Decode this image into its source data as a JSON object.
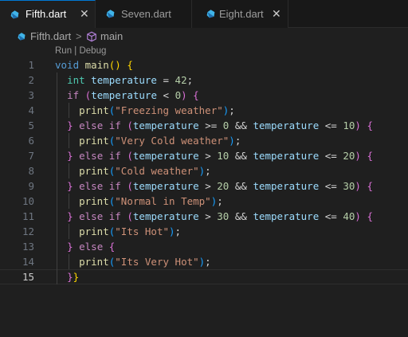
{
  "tabs": [
    {
      "label": "Fifth.dart",
      "active": true,
      "close": "✕"
    },
    {
      "label": "Seven.dart",
      "active": false
    },
    {
      "label": "Eight.dart",
      "active": false,
      "close": "✕"
    }
  ],
  "breadcrumb": {
    "file": "Fifth.dart",
    "separator": ">",
    "symbol": "main"
  },
  "editor": {
    "codelens": "Run | Debug",
    "line_numbers": [
      "1",
      "2",
      "3",
      "4",
      "5",
      "6",
      "7",
      "8",
      "9",
      "10",
      "11",
      "12",
      "13",
      "14",
      "15"
    ],
    "current_line": 15,
    "code_lines": [
      [
        [
          "kw",
          "void"
        ],
        [
          "pun",
          " "
        ],
        [
          "fn",
          "main"
        ],
        [
          "b1",
          "()"
        ],
        [
          "pun",
          " "
        ],
        [
          "b1",
          "{"
        ]
      ],
      [
        [
          "pun",
          "  "
        ],
        [
          "ty",
          "int"
        ],
        [
          "pun",
          " "
        ],
        [
          "var",
          "temperature"
        ],
        [
          "pun",
          " = "
        ],
        [
          "num",
          "42"
        ],
        [
          "pun",
          ";"
        ]
      ],
      [
        [
          "pun",
          "  "
        ],
        [
          "ctl",
          "if"
        ],
        [
          "pun",
          " "
        ],
        [
          "b2",
          "("
        ],
        [
          "var",
          "temperature"
        ],
        [
          "pun",
          " < "
        ],
        [
          "num",
          "0"
        ],
        [
          "b2",
          ")"
        ],
        [
          "pun",
          " "
        ],
        [
          "b2",
          "{"
        ]
      ],
      [
        [
          "pun",
          "    "
        ],
        [
          "fn",
          "print"
        ],
        [
          "b3",
          "("
        ],
        [
          "str",
          "\"Freezing weather\""
        ],
        [
          "b3",
          ")"
        ],
        [
          "pun",
          ";"
        ]
      ],
      [
        [
          "pun",
          "  "
        ],
        [
          "b2",
          "}"
        ],
        [
          "pun",
          " "
        ],
        [
          "ctl",
          "else"
        ],
        [
          "pun",
          " "
        ],
        [
          "ctl",
          "if"
        ],
        [
          "pun",
          " "
        ],
        [
          "b2",
          "("
        ],
        [
          "var",
          "temperature"
        ],
        [
          "pun",
          " >= "
        ],
        [
          "num",
          "0"
        ],
        [
          "pun",
          " && "
        ],
        [
          "var",
          "temperature"
        ],
        [
          "pun",
          " <= "
        ],
        [
          "num",
          "10"
        ],
        [
          "b2",
          ")"
        ],
        [
          "pun",
          " "
        ],
        [
          "b2",
          "{"
        ]
      ],
      [
        [
          "pun",
          "    "
        ],
        [
          "fn",
          "print"
        ],
        [
          "b3",
          "("
        ],
        [
          "str",
          "\"Very Cold weather\""
        ],
        [
          "b3",
          ")"
        ],
        [
          "pun",
          ";"
        ]
      ],
      [
        [
          "pun",
          "  "
        ],
        [
          "b2",
          "}"
        ],
        [
          "pun",
          " "
        ],
        [
          "ctl",
          "else"
        ],
        [
          "pun",
          " "
        ],
        [
          "ctl",
          "if"
        ],
        [
          "pun",
          " "
        ],
        [
          "b2",
          "("
        ],
        [
          "var",
          "temperature"
        ],
        [
          "pun",
          " > "
        ],
        [
          "num",
          "10"
        ],
        [
          "pun",
          " && "
        ],
        [
          "var",
          "temperature"
        ],
        [
          "pun",
          " <= "
        ],
        [
          "num",
          "20"
        ],
        [
          "b2",
          ")"
        ],
        [
          "pun",
          " "
        ],
        [
          "b2",
          "{"
        ]
      ],
      [
        [
          "pun",
          "    "
        ],
        [
          "fn",
          "print"
        ],
        [
          "b3",
          "("
        ],
        [
          "str",
          "\"Cold weather\""
        ],
        [
          "b3",
          ")"
        ],
        [
          "pun",
          ";"
        ]
      ],
      [
        [
          "pun",
          "  "
        ],
        [
          "b2",
          "}"
        ],
        [
          "pun",
          " "
        ],
        [
          "ctl",
          "else"
        ],
        [
          "pun",
          " "
        ],
        [
          "ctl",
          "if"
        ],
        [
          "pun",
          " "
        ],
        [
          "b2",
          "("
        ],
        [
          "var",
          "temperature"
        ],
        [
          "pun",
          " > "
        ],
        [
          "num",
          "20"
        ],
        [
          "pun",
          " && "
        ],
        [
          "var",
          "temperature"
        ],
        [
          "pun",
          " <= "
        ],
        [
          "num",
          "30"
        ],
        [
          "b2",
          ")"
        ],
        [
          "pun",
          " "
        ],
        [
          "b2",
          "{"
        ]
      ],
      [
        [
          "pun",
          "    "
        ],
        [
          "fn",
          "print"
        ],
        [
          "b3",
          "("
        ],
        [
          "str",
          "\"Normal in Temp\""
        ],
        [
          "b3",
          ")"
        ],
        [
          "pun",
          ";"
        ]
      ],
      [
        [
          "pun",
          "  "
        ],
        [
          "b2",
          "}"
        ],
        [
          "pun",
          " "
        ],
        [
          "ctl",
          "else"
        ],
        [
          "pun",
          " "
        ],
        [
          "ctl",
          "if"
        ],
        [
          "pun",
          " "
        ],
        [
          "b2",
          "("
        ],
        [
          "var",
          "temperature"
        ],
        [
          "pun",
          " > "
        ],
        [
          "num",
          "30"
        ],
        [
          "pun",
          " && "
        ],
        [
          "var",
          "temperature"
        ],
        [
          "pun",
          " <= "
        ],
        [
          "num",
          "40"
        ],
        [
          "b2",
          ")"
        ],
        [
          "pun",
          " "
        ],
        [
          "b2",
          "{"
        ]
      ],
      [
        [
          "pun",
          "    "
        ],
        [
          "fn",
          "print"
        ],
        [
          "b3",
          "("
        ],
        [
          "str",
          "\"Its Hot\""
        ],
        [
          "b3",
          ")"
        ],
        [
          "pun",
          ";"
        ]
      ],
      [
        [
          "pun",
          "  "
        ],
        [
          "b2",
          "}"
        ],
        [
          "pun",
          " "
        ],
        [
          "ctl",
          "else"
        ],
        [
          "pun",
          " "
        ],
        [
          "b2",
          "{"
        ]
      ],
      [
        [
          "pun",
          "    "
        ],
        [
          "fn",
          "print"
        ],
        [
          "b3",
          "("
        ],
        [
          "str",
          "\"Its Very Hot\""
        ],
        [
          "b3",
          ")"
        ],
        [
          "pun",
          ";"
        ]
      ],
      [
        [
          "pun",
          "  "
        ],
        [
          "b2",
          "}"
        ],
        [
          "b1",
          "}"
        ]
      ]
    ]
  },
  "colors": {
    "background": "#1f1f1f",
    "tab_bar": "#181818",
    "dart_icon": "#40b4e8",
    "symbol_icon": "#b180d7"
  },
  "icons": {
    "tab_file": "dart-icon",
    "breadcrumb_file": "dart-icon",
    "breadcrumb_symbol": "cube-method-icon"
  }
}
